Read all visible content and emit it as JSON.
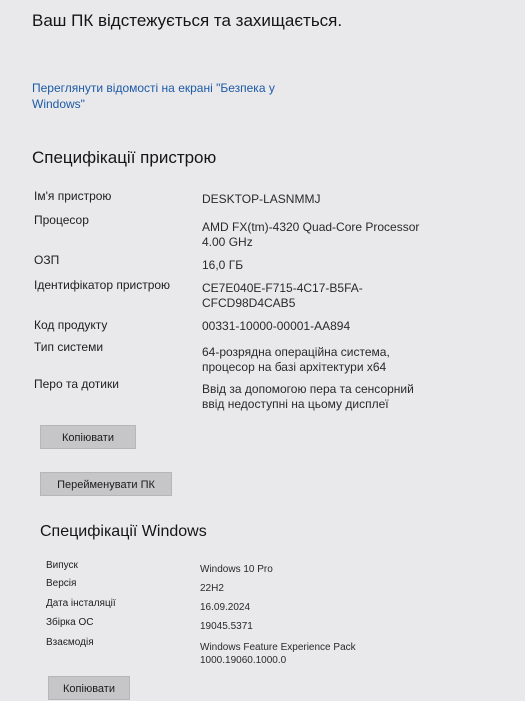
{
  "security": {
    "status_text": "Ваш ПК відстежується та захищається.",
    "link_text": "Переглянути відомості на екрані \"Безпека у Windows\""
  },
  "device_specs": {
    "title": "Специфікації пристрою",
    "rows": [
      {
        "label": "Ім'я пристрою",
        "value": "DESKTOP-LASNMMJ"
      },
      {
        "label": "Процесор",
        "value": "AMD FX(tm)-4320 Quad-Core Processor 4.00 GHz"
      },
      {
        "label": "ОЗП",
        "value": "16,0 ГБ"
      },
      {
        "label": "Ідентифікатор пристрою",
        "value": "CE7E040E-F715-4C17-B5FA-CFCD98D4CAB5"
      },
      {
        "label": "Код продукту",
        "value": "00331-10000-00001-AA894"
      },
      {
        "label": "Тип системи",
        "value": "64-розрядна операційна система, процесор на базі архітектури x64"
      },
      {
        "label": "Перо та дотики",
        "value": "Ввід за допомогою пера та сенсорний ввід недоступні на цьому дисплеї"
      }
    ],
    "copy_label": "Копіювати",
    "rename_label": "Перейменувати ПК"
  },
  "windows_specs": {
    "title": "Специфікації Windows",
    "rows": [
      {
        "label": "Випуск",
        "value": "Windows 10 Pro"
      },
      {
        "label": "Версія",
        "value": "22H2"
      },
      {
        "label": "Дата інсталяції",
        "value": "16.09.2024"
      },
      {
        "label": "Збірка ОС",
        "value": "19045.5371"
      },
      {
        "label": "Взаємодія",
        "value": "Windows Feature Experience Pack 1000.19060.1000.0"
      }
    ],
    "copy_label": "Копіювати"
  }
}
